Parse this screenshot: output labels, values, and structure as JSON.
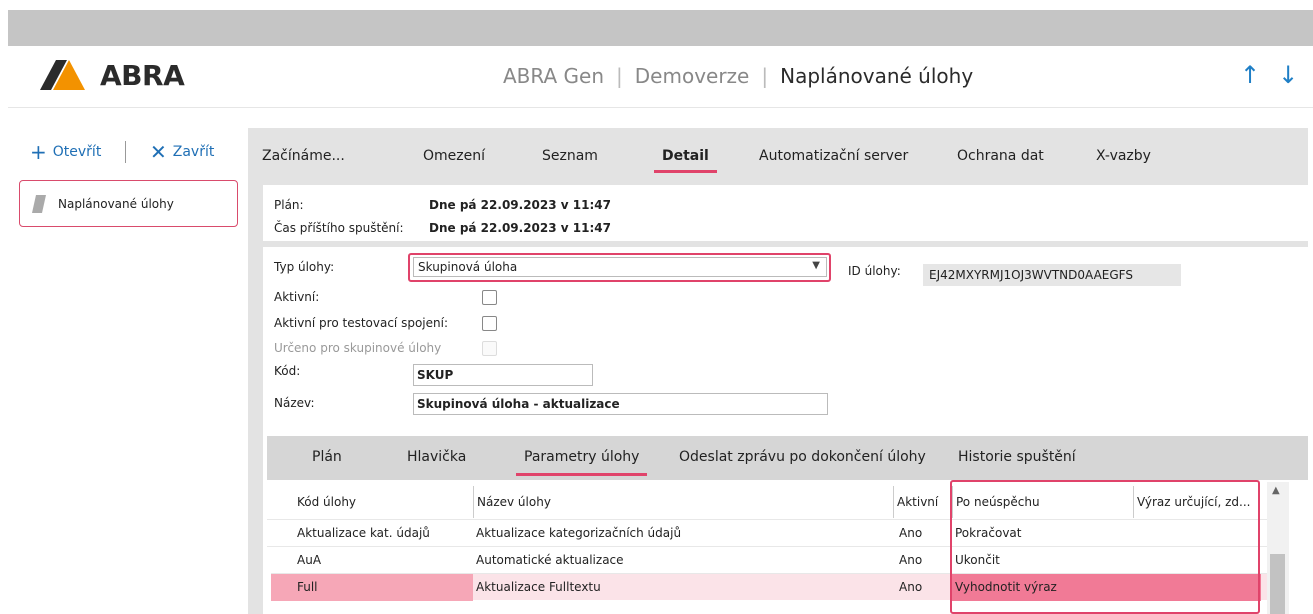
{
  "app": {
    "logo_text": "ABRA",
    "title_parts": [
      "ABRA Gen",
      "Demoverze"
    ],
    "title_current": "Naplánované úlohy",
    "nav_up_icon": "arrow-up-icon",
    "nav_down_icon": "arrow-down-icon",
    "accent_color": "#e0436a",
    "link_color": "#1f6fb5"
  },
  "toolbar": {
    "open_icon": "+",
    "open_label": "Otevřít",
    "close_icon": "✕",
    "close_label": "Zavřít"
  },
  "sidebar": {
    "items": [
      {
        "label": "Naplánované úlohy",
        "icon": "document-icon"
      }
    ]
  },
  "tabs": [
    {
      "label": "Začínáme...",
      "active": false
    },
    {
      "label": "Omezení",
      "active": false
    },
    {
      "label": "Seznam",
      "active": false
    },
    {
      "label": "Detail",
      "active": true
    },
    {
      "label": "Automatizační server",
      "active": false
    },
    {
      "label": "Ochrana dat",
      "active": false
    },
    {
      "label": "X-vazby",
      "active": false
    }
  ],
  "plan_info": {
    "plan_label": "Plán:",
    "plan_value": "Dne pá 22.09.2023 v 11:47",
    "next_run_label": "Čas příštího spuštění:",
    "next_run_value": "Dne pá 22.09.2023 v 11:47"
  },
  "form": {
    "task_type_label": "Typ úlohy:",
    "task_type_value": "Skupinová úloha",
    "task_id_label": "ID úlohy:",
    "task_id_value": "EJ42MXYRMJ1OJ3WVTND0AAEGFS",
    "active_label": "Aktivní:",
    "active_checked": false,
    "active_test_label": "Aktivní pro testovací spojení:",
    "active_test_checked": false,
    "group_label": "Určeno pro skupinové úlohy",
    "group_checked": false,
    "code_label": "Kód:",
    "code_value": "SKUP",
    "name_label": "Název:",
    "name_value": "Skupinová úloha - aktualizace"
  },
  "sub_tabs": [
    {
      "label": "Plán",
      "active": false
    },
    {
      "label": "Hlavička",
      "active": false
    },
    {
      "label": "Parametry úlohy",
      "active": true
    },
    {
      "label": "Odeslat zprávu po dokončení úlohy",
      "active": false
    },
    {
      "label": "Historie spuštění",
      "active": false
    }
  ],
  "grid": {
    "columns": [
      "Kód úlohy",
      "Název úlohy",
      "Aktivní",
      "Po neúspěchu",
      "Výraz určující, zd..."
    ],
    "rows": [
      {
        "code": "Aktualizace kat. údajů",
        "name": "Aktualizace kategorizačních údajů",
        "active": "Ano",
        "on_fail": "Pokračovat",
        "expr": "",
        "selected": false
      },
      {
        "code": "AuA",
        "name": "Automatické aktualizace",
        "active": "Ano",
        "on_fail": "Ukončit",
        "expr": "",
        "selected": false
      },
      {
        "code": "Full",
        "name": "Aktualizace Fulltextu",
        "active": "Ano",
        "on_fail": "Vyhodnotit výraz",
        "expr": "",
        "selected": true
      }
    ]
  }
}
